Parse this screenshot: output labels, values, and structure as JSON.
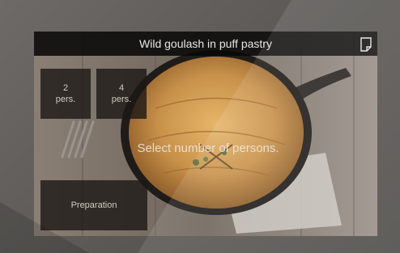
{
  "recipe": {
    "title": "Wild goulash in puff pastry"
  },
  "header": {
    "notes_icon": "document-icon"
  },
  "persons": {
    "options": [
      {
        "count": "2",
        "unit": "pers."
      },
      {
        "count": "4",
        "unit": "pers."
      }
    ],
    "prompt": "Select number of persons."
  },
  "actions": {
    "preparation_label": "Preparation"
  },
  "colors": {
    "overlay_tile": "#1c1815",
    "title_bar": "#080808",
    "text": "#e6e6e6"
  }
}
